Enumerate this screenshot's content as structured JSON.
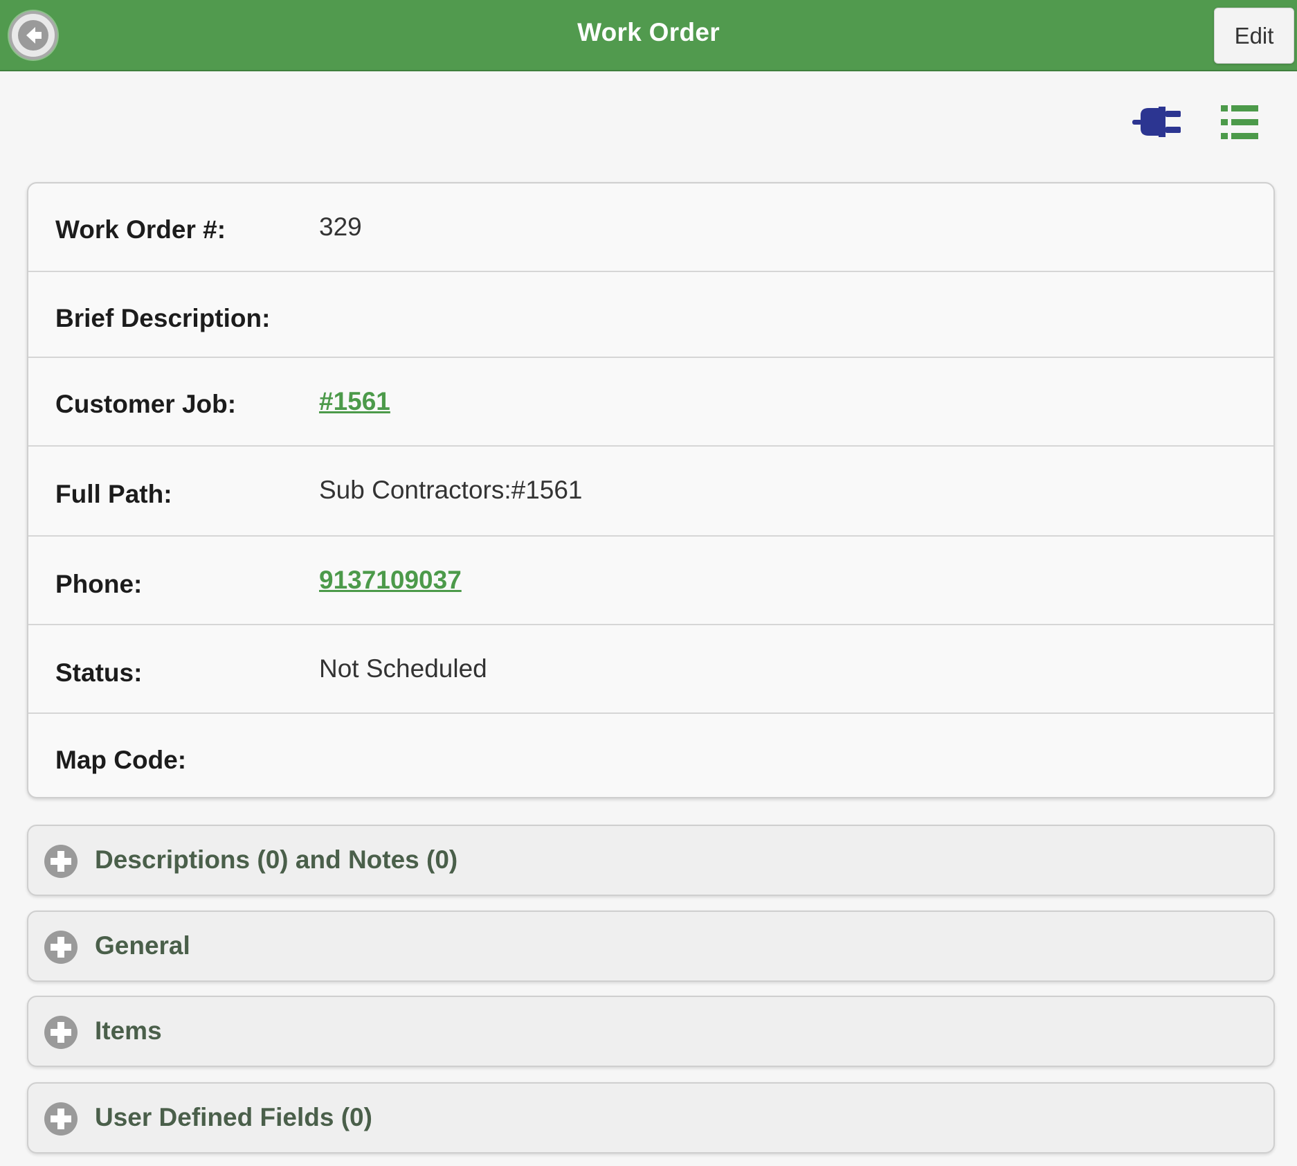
{
  "header": {
    "title": "Work Order",
    "edit_label": "Edit"
  },
  "toolbar": {
    "icons": [
      "plug-icon",
      "list-icon"
    ]
  },
  "fields": {
    "work_order": {
      "label": "Work Order #:",
      "value": "329"
    },
    "brief_description": {
      "label": "Brief Description:",
      "value": ""
    },
    "customer_job": {
      "label": "Customer Job:",
      "value": "#1561"
    },
    "full_path": {
      "label": "Full Path:",
      "value": "Sub Contractors:#1561"
    },
    "phone": {
      "label": "Phone:",
      "value": "9137109037"
    },
    "status": {
      "label": "Status:",
      "value": "Not Scheduled"
    },
    "map_code": {
      "label": "Map Code:",
      "value": ""
    }
  },
  "sections": [
    {
      "title": "Descriptions (0) and Notes (0)"
    },
    {
      "title": "General"
    },
    {
      "title": "Items"
    },
    {
      "title": "User Defined Fields (0)"
    }
  ],
  "colors": {
    "header_green": "#519a4e",
    "link_green": "#4c9a4a",
    "plug_blue": "#2c3591",
    "list_green": "#4c9a4a"
  }
}
